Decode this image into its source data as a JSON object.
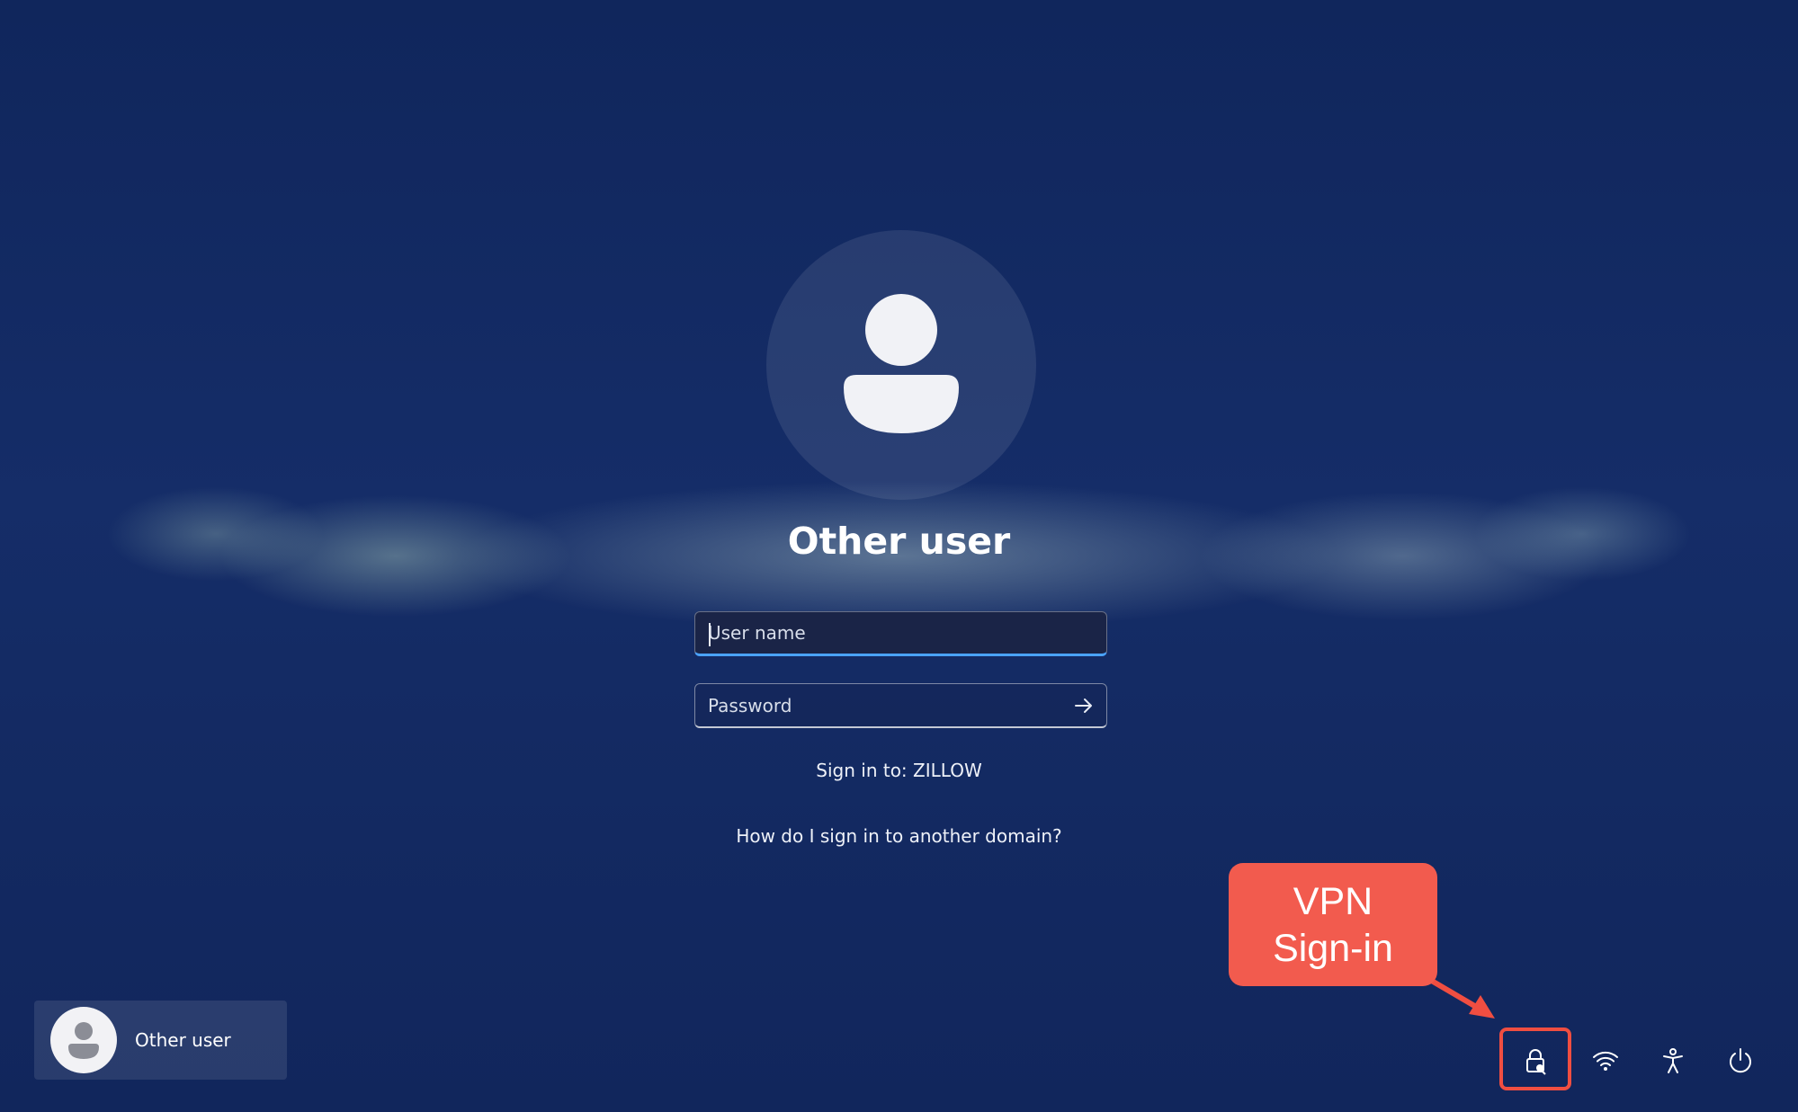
{
  "login": {
    "title": "Other user",
    "username_placeholder": "User name",
    "username_value": "",
    "password_placeholder": "Password",
    "password_value": "",
    "sign_in_to": "Sign in to: ZILLOW",
    "other_domain_link": "How do I sign in to another domain?"
  },
  "user_switcher": {
    "label": "Other user",
    "icon": "user-icon"
  },
  "system_tray": {
    "items": [
      {
        "name": "network-sign-in-icon",
        "label": "Network sign-in"
      },
      {
        "name": "wifi-icon",
        "label": "Network"
      },
      {
        "name": "accessibility-icon",
        "label": "Accessibility"
      },
      {
        "name": "power-icon",
        "label": "Power"
      }
    ]
  },
  "annotation": {
    "line1": "VPN",
    "line2": "Sign-in",
    "color": "#f25b4e"
  },
  "colors": {
    "background": "#13285e",
    "focus_accent": "#4aa3ff"
  }
}
